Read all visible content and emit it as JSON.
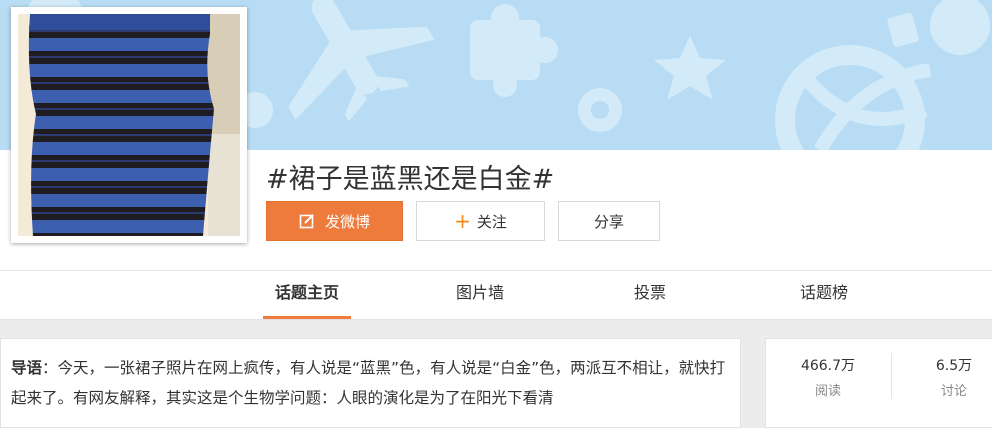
{
  "topic": {
    "title": "#裙子是蓝黑还是白金#"
  },
  "actions": {
    "post_label": "发微博",
    "follow_label": "关注",
    "follow_plus": "+",
    "share_label": "分享"
  },
  "tabs": [
    {
      "label": "话题主页",
      "active": true
    },
    {
      "label": "图片墙",
      "active": false
    },
    {
      "label": "投票",
      "active": false
    },
    {
      "label": "话题榜",
      "active": false
    }
  ],
  "intro": {
    "label": "导语",
    "text": "：今天，一张裙子照片在网上疯传，有人说是“蓝黑”色，有人说是“白金”色，两派互不相让，就快打起来了。有网友解释，其实这是个生物学问题：人眼的演化是为了在阳光下看清"
  },
  "stats": [
    {
      "value": "466.7万",
      "label": "阅读"
    },
    {
      "value": "6.5万",
      "label": "讨论"
    }
  ],
  "colors": {
    "accent": "#ee7b3c",
    "banner": "#b8dcf3",
    "banner_shapes": "#d3ebf9",
    "dress_blue": "#3d5fb0",
    "dress_black": "#1f1c22"
  },
  "icons": {
    "post": "edit-icon",
    "banner": [
      "airplane-icon",
      "puzzle-icon",
      "star-icon",
      "ball-icon",
      "aries-icon"
    ]
  }
}
